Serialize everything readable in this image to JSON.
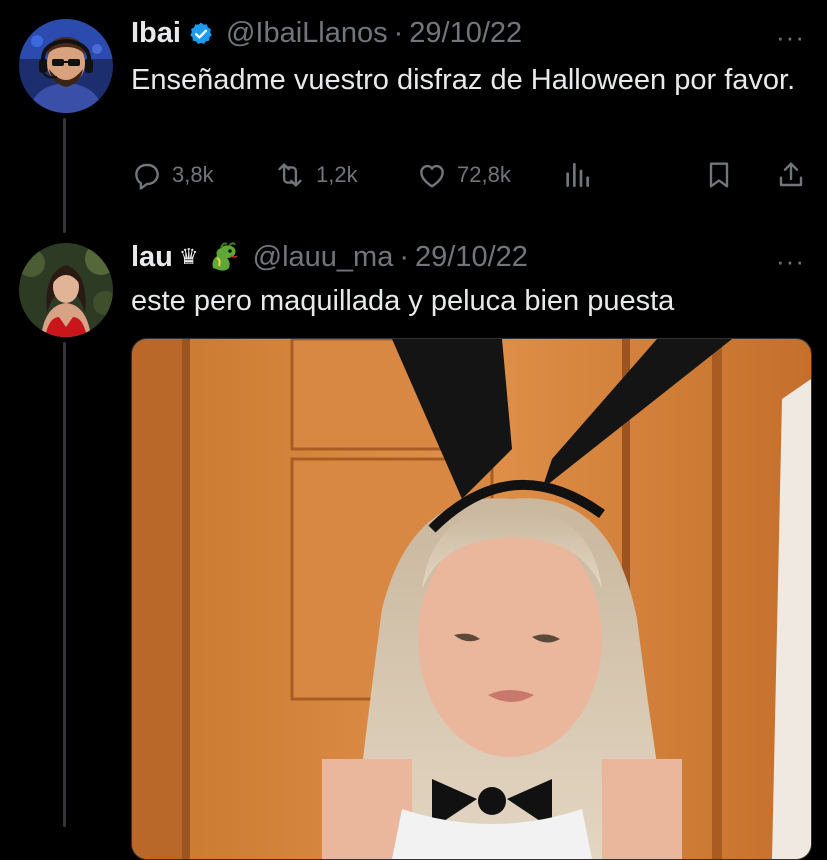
{
  "tweet1": {
    "display_name": "Ibai",
    "handle": "@IbaiLlanos",
    "separator": "·",
    "date": "29/10/22",
    "more": "···",
    "text": "Enseñadme vuestro disfraz de Halloween por favor.",
    "replies": "3,8k",
    "retweets": "1,2k",
    "likes": "72,8k"
  },
  "tweet2": {
    "display_name": "lau",
    "name_emoji": "♛",
    "handle": "@lauu_ma",
    "separator": "·",
    "date": "29/10/22",
    "more": "···",
    "text": "este pero maquillada y peluca bien puesta"
  },
  "colors": {
    "background": "#000000",
    "text": "#e7e9ea",
    "muted": "#71767b",
    "verified": "#1d9bf0",
    "thread_line": "#333639"
  }
}
